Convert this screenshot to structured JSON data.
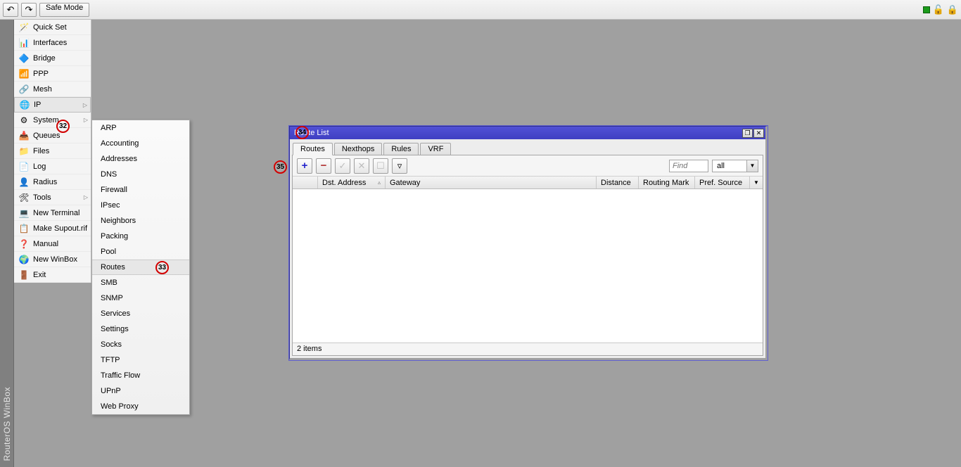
{
  "app_title": "RouterOS WinBox",
  "toolbar": {
    "safe_mode": "Safe Mode"
  },
  "sidebar": {
    "items": [
      {
        "label": "Quick Set"
      },
      {
        "label": "Interfaces"
      },
      {
        "label": "Bridge"
      },
      {
        "label": "PPP"
      },
      {
        "label": "Mesh"
      },
      {
        "label": "IP",
        "sub": true
      },
      {
        "label": "System",
        "sub": true
      },
      {
        "label": "Queues"
      },
      {
        "label": "Files"
      },
      {
        "label": "Log"
      },
      {
        "label": "Radius"
      },
      {
        "label": "Tools",
        "sub": true
      },
      {
        "label": "New Terminal"
      },
      {
        "label": "Make Supout.rif"
      },
      {
        "label": "Manual"
      },
      {
        "label": "New WinBox"
      },
      {
        "label": "Exit"
      }
    ]
  },
  "ip_submenu": [
    "ARP",
    "Accounting",
    "Addresses",
    "DNS",
    "Firewall",
    "IPsec",
    "Neighbors",
    "Packing",
    "Pool",
    "Routes",
    "SMB",
    "SNMP",
    "Services",
    "Settings",
    "Socks",
    "TFTP",
    "Traffic Flow",
    "UPnP",
    "Web Proxy"
  ],
  "annotations": {
    "a32": "32",
    "a33": "33",
    "a34": "34",
    "a35": "35"
  },
  "route_window": {
    "title": "Route List",
    "tabs": [
      "Routes",
      "Nexthops",
      "Rules",
      "VRF"
    ],
    "find_placeholder": "Find",
    "filter_value": "all",
    "columns": [
      "",
      "Dst. Address",
      "Gateway",
      "Distance",
      "Routing Mark",
      "Pref. Source"
    ],
    "status": "2 items"
  }
}
